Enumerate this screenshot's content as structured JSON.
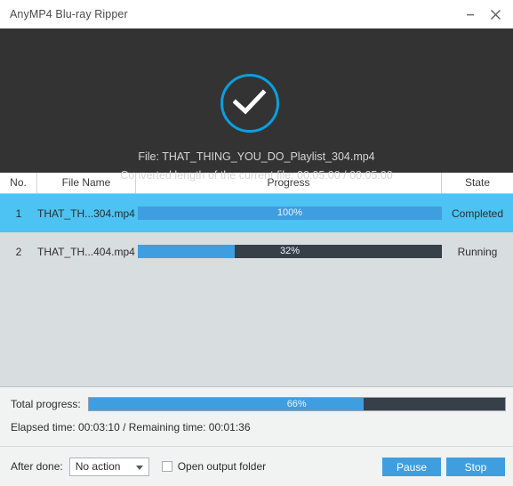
{
  "window": {
    "title": "AnyMP4 Blu-ray Ripper",
    "minimize_icon": "minimize-icon",
    "close_icon": "close-icon"
  },
  "banner": {
    "status_icon": "check-circle-icon",
    "file_line": "File: THAT_THING_YOU_DO_Playlist_304.mp4",
    "length_line": "Converted length of the current file: 00:05:00 / 00:05:00",
    "accent_color": "#0a9fe0",
    "background_color": "#333333"
  },
  "table": {
    "columns": {
      "no": "No.",
      "file_name": "File Name",
      "progress": "Progress",
      "state": "State"
    },
    "rows": [
      {
        "no": "1",
        "file_name": "THAT_TH...304.mp4",
        "percent_label": "100%",
        "percent_value": 100,
        "state": "Completed",
        "selected": true
      },
      {
        "no": "2",
        "file_name": "THAT_TH...404.mp4",
        "percent_label": "32%",
        "percent_value": 32,
        "state": "Running",
        "selected": false
      }
    ],
    "selected_row_color": "#4cc3f2",
    "body_background": "#d8dde0"
  },
  "bottom": {
    "total_label": "Total progress:",
    "total_percent_label": "66%",
    "total_percent_value": 66,
    "times_line": "Elapsed time: 00:03:10 / Remaining time: 00:01:36"
  },
  "footer": {
    "after_done_label": "After done:",
    "after_done_value": "No action",
    "open_output_folder_label": "Open output folder",
    "open_output_folder_checked": false,
    "pause_button": "Pause",
    "stop_button": "Stop",
    "button_color": "#3f9ee0"
  }
}
